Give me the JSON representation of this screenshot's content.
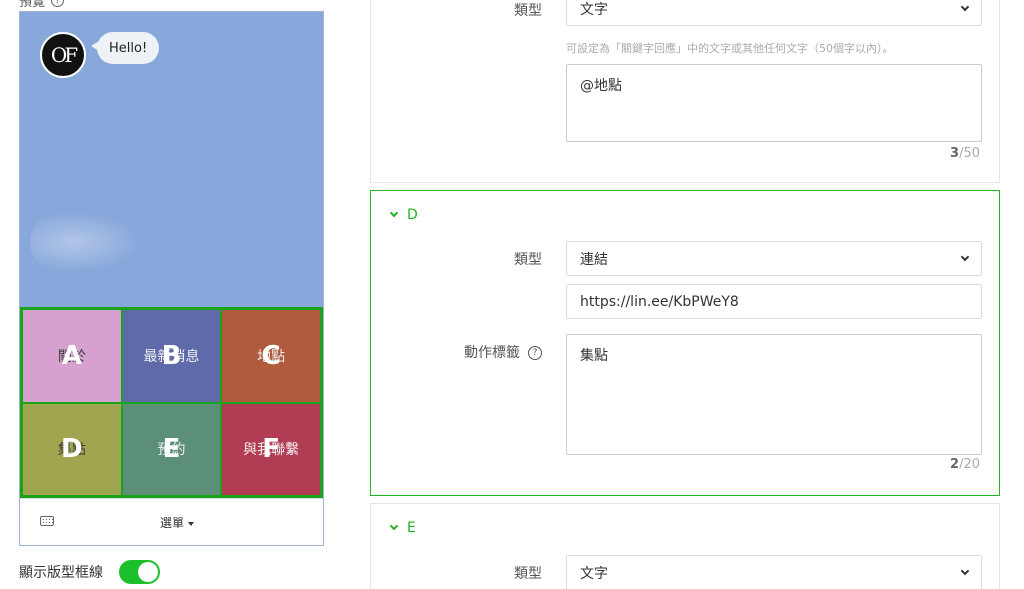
{
  "preview": {
    "label": "預覽",
    "chat_message": "Hello!",
    "avatar_text": "OF",
    "cells": [
      {
        "letter": "A",
        "text": "關於",
        "color": "#d6a1cf"
      },
      {
        "letter": "B",
        "text": "最新消息",
        "color": "#5e6aa9"
      },
      {
        "letter": "C",
        "text": "地點",
        "color": "#b25a3c"
      },
      {
        "letter": "D",
        "text": "集點",
        "color": "#a0a650"
      },
      {
        "letter": "E",
        "text": "預約",
        "color": "#5b8f78"
      },
      {
        "letter": "F",
        "text": "與我聯繫",
        "color": "#b33c55"
      }
    ],
    "menu_label": "選單",
    "border_toggle_label": "顯示版型框線",
    "border_toggle_on": true
  },
  "section_c": {
    "type_label": "類型",
    "type_value": "文字",
    "hint": "可設定為「關鍵字回應」中的文字或其他任何文字（50個字以內）。",
    "text_value": "@地點",
    "counter_current": "3",
    "counter_max": "/50"
  },
  "section_d": {
    "title": "D",
    "type_label": "類型",
    "type_value": "連結",
    "url_value": "https://lin.ee/KbPWeY8",
    "action_label": "動作標籤",
    "action_value": "集點",
    "counter_current": "2",
    "counter_max": "/20"
  },
  "section_e": {
    "title": "E",
    "type_label": "類型",
    "type_value": "文字"
  }
}
